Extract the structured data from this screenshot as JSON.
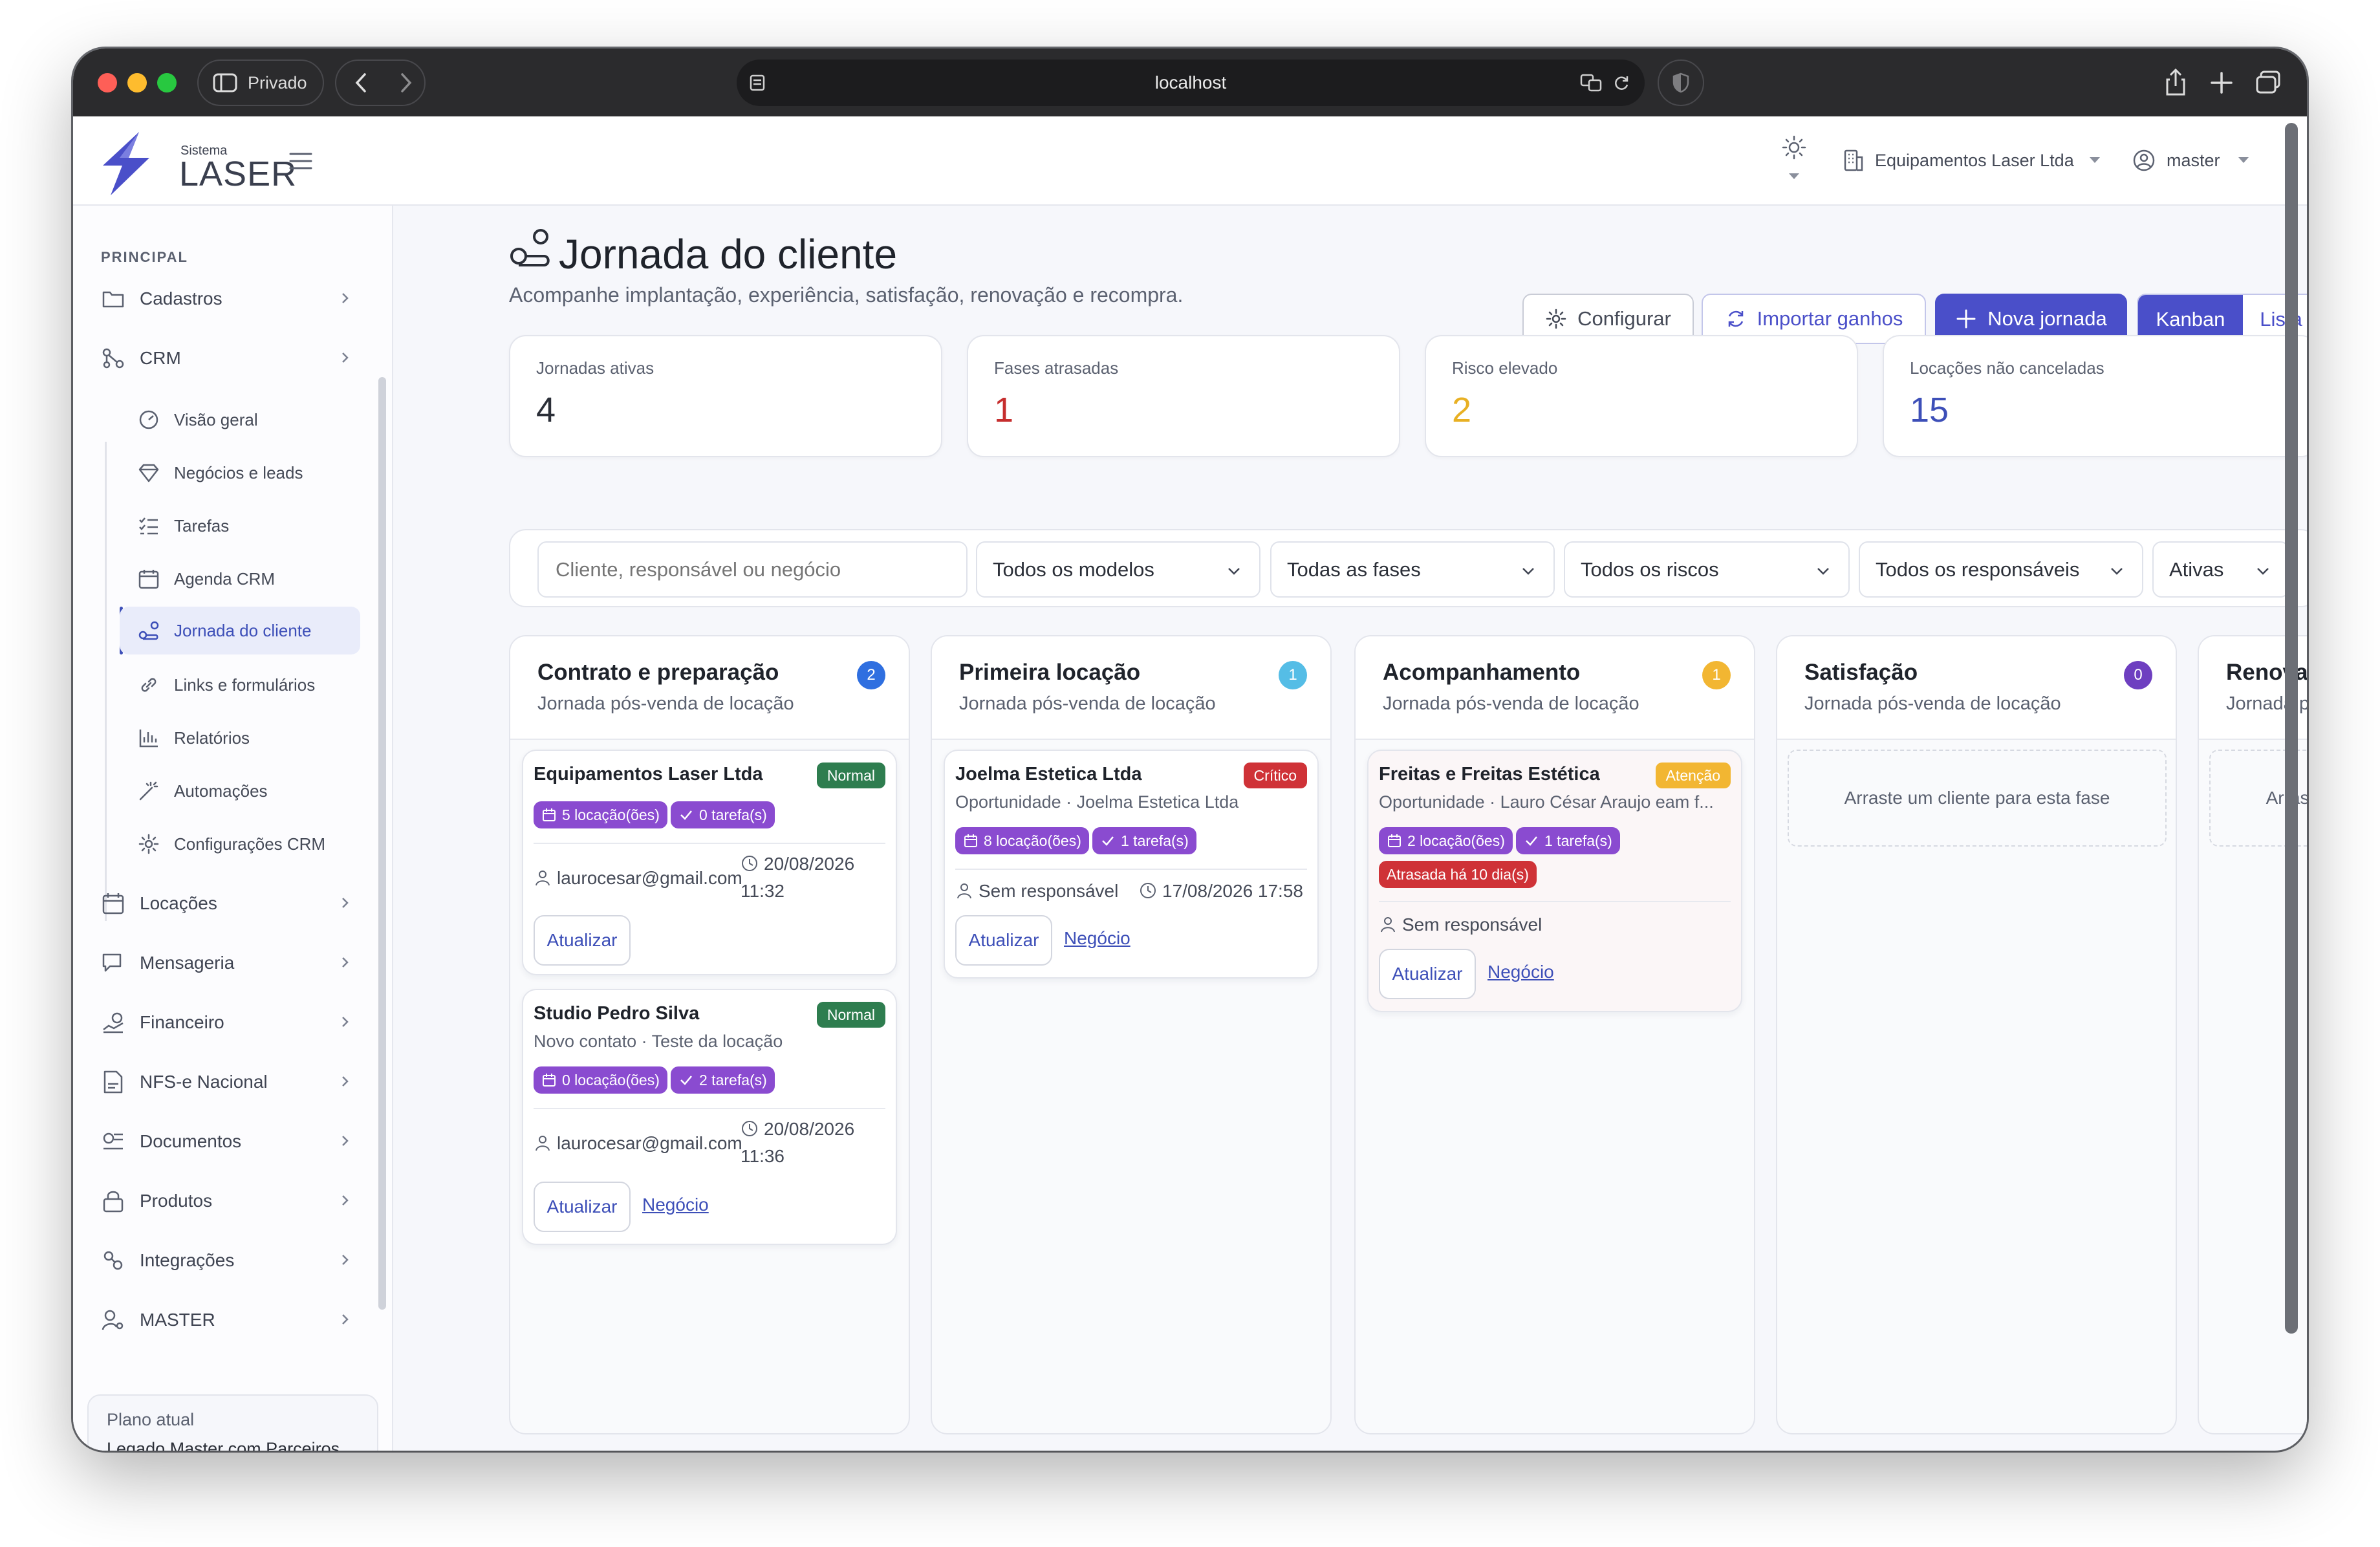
{
  "browser": {
    "tab_label": "Privado",
    "url": "localhost"
  },
  "app": {
    "logo_small": "Sistema",
    "logo_big": "LASER",
    "company": "Equipamentos Laser Ltda",
    "user": "master"
  },
  "sidebar": {
    "section": "PRINCIPAL",
    "items": {
      "cadastros": "Cadastros",
      "crm": "CRM",
      "locacoes": "Locações",
      "mensageria": "Mensageria",
      "financeiro": "Financeiro",
      "nfse": "NFS-e Nacional",
      "documentos": "Documentos",
      "produtos": "Produtos",
      "integracoes": "Integrações",
      "master": "MASTER"
    },
    "crm_sub": {
      "visao": "Visão geral",
      "negocios": "Negócios e leads",
      "tarefas": "Tarefas",
      "agenda": "Agenda CRM",
      "jornada": "Jornada do cliente",
      "links": "Links e formulários",
      "relatorios": "Relatórios",
      "automacoes": "Automações",
      "config": "Configurações CRM"
    },
    "plan_label": "Plano atual",
    "plan_value": "Legado Master com Parceiros"
  },
  "page": {
    "title": "Jornada do cliente",
    "subtitle": "Acompanhe implantação, experiência, satisfação, renovação e recompra.",
    "btn_configurar": "Configurar",
    "btn_importar": "Importar ganhos",
    "btn_nova": "Nova jornada",
    "view_kanban": "Kanban",
    "view_lista": "Lista"
  },
  "stats": [
    {
      "label": "Jornadas ativas",
      "value": "4",
      "color": "#2b2f38"
    },
    {
      "label": "Fases atrasadas",
      "value": "1",
      "color": "#c62e2e"
    },
    {
      "label": "Risco elevado",
      "value": "2",
      "color": "#e8b023"
    },
    {
      "label": "Locações não canceladas",
      "value": "15",
      "color": "#3d4fb8"
    }
  ],
  "filters": {
    "search_placeholder": "Cliente, responsável ou negócio",
    "modelos": "Todos os modelos",
    "fases": "Todas as fases",
    "riscos": "Todos os riscos",
    "responsaveis": "Todos os responsáveis",
    "status": "Ativas"
  },
  "columns": [
    {
      "title": "Contrato e preparação",
      "subtitle": "Jornada pós-venda de locação",
      "count": "2",
      "badge_color": "#2f6fe0"
    },
    {
      "title": "Primeira locação",
      "subtitle": "Jornada pós-venda de locação",
      "count": "1",
      "badge_color": "#55bde6"
    },
    {
      "title": "Acompanhamento",
      "subtitle": "Jornada pós-venda de locação",
      "count": "1",
      "badge_color": "#f2b632"
    },
    {
      "title": "Satisfação",
      "subtitle": "Jornada pós-venda de locação",
      "count": "0",
      "badge_color": "#6e3fc0",
      "empty": "Arraste um cliente para esta fase"
    },
    {
      "title": "Renovação",
      "subtitle": "Jornada pós-venda de locação",
      "empty": "Arraste um cliente para esta fase"
    }
  ],
  "cards": {
    "c1": {
      "title": "Equipamentos Laser Ltda",
      "priority": "Normal",
      "chip_loc": "5 locação(ões)",
      "chip_task": "0 tarefa(s)",
      "email": "laurocesar@gmail.com",
      "date": "20/08/2026",
      "time": "11:32",
      "btn": "Atualizar"
    },
    "c2": {
      "title": "Studio Pedro Silva",
      "priority": "Normal",
      "subtitle": "Novo contato · Teste da locação",
      "chip_loc": "0 locação(ões)",
      "chip_task": "2 tarefa(s)",
      "email": "laurocesar@gmail.com",
      "date": "20/08/2026",
      "time": "11:36",
      "btn": "Atualizar",
      "link": "Negócio"
    },
    "c3": {
      "title": "Joelma Estetica Ltda",
      "priority": "Crítico",
      "subtitle": "Oportunidade · Joelma Estetica Ltda",
      "chip_loc": "8 locação(ões)",
      "chip_task": "1 tarefa(s)",
      "owner": "Sem responsável",
      "datetime": "17/08/2026 17:58",
      "btn": "Atualizar",
      "link": "Negócio"
    },
    "c4": {
      "title": "Freitas e Freitas Estética",
      "priority": "Atenção",
      "subtitle": "Oportunidade · Lauro César Araujo eam f...",
      "chip_loc": "2 locação(ões)",
      "chip_task": "1 tarefa(s)",
      "late": "Atrasada há 10 dia(s)",
      "owner": "Sem responsável",
      "btn": "Atualizar",
      "link": "Negócio"
    }
  },
  "colors": {
    "primary": "#4a4fc9",
    "chip": "#8a4bd0",
    "normal": "#2e7d4f",
    "critical": "#cf3237",
    "attention": "#f2b632"
  }
}
